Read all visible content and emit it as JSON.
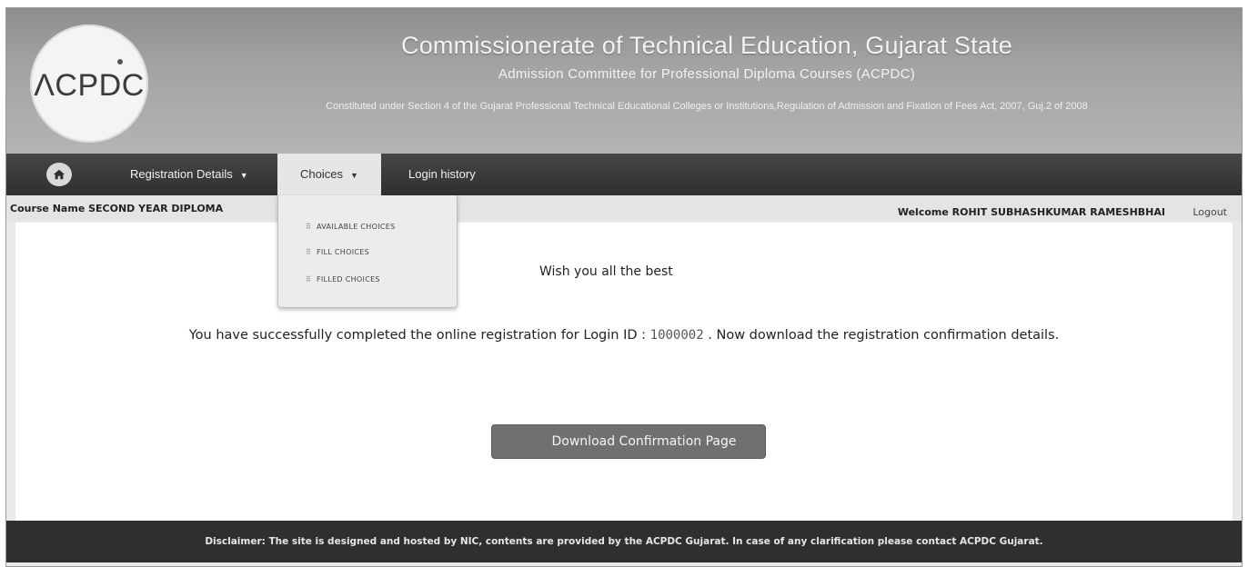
{
  "header": {
    "logo_text": "ΛCPDC",
    "title": "Commissionerate of Technical Education, Gujarat State",
    "subtitle": "Admission Committee for Professional Diploma Courses (ACPDC)",
    "note": "Constituted under Section 4 of the Gujarat Professional Technical Educational Colleges or Institutions,Regulation of Admission and Fixation of Fees Act, 2007, Guj.2 of 2008"
  },
  "nav": {
    "home_icon": "home-icon",
    "items": [
      {
        "label": "Registration Details",
        "has_caret": true
      },
      {
        "label": "Choices",
        "has_caret": true,
        "active": true
      },
      {
        "label": "Login history",
        "has_caret": false
      }
    ]
  },
  "dropdown": {
    "items": [
      {
        "label": "AVAILABLE CHOICES"
      },
      {
        "label": "FILL CHOICES"
      },
      {
        "label": "FILLED CHOICES"
      }
    ]
  },
  "infobar": {
    "course": "Course Name SECOND YEAR DIPLOMA",
    "welcome": "Welcome ROHIT SUBHASHKUMAR RAMESHBHAI",
    "logout": "Logout"
  },
  "content": {
    "wish": "Wish you all the best",
    "success_prefix": "You have successfully completed the online registration for Login ID :",
    "login_id": "1000002",
    "success_suffix": ". Now download the registration confirmation details.",
    "download_button": "Download Confirmation Page"
  },
  "footer": {
    "disclaimer": "Disclaimer: The site is designed and hosted by NIC, contents are provided by the ACPDC Gujarat. In case of any clarification please contact ACPDC Gujarat."
  },
  "colors": {
    "header_bg": "#a3a3a3",
    "nav_bg": "#333333",
    "button_bg": "#707070",
    "footer_bg": "#2f2f2f"
  }
}
